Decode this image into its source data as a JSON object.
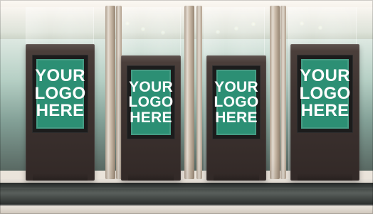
{
  "scene": {
    "kiosks": [
      {
        "line1": "YOUR",
        "line2": "LOGO",
        "line3": "HERE"
      },
      {
        "line1": "YOUR",
        "line2": "LOGO",
        "line3": "HERE"
      },
      {
        "line1": "YOUR",
        "line2": "LOGO",
        "line3": "HERE"
      },
      {
        "line1": "YOUR",
        "line2": "LOGO",
        "line3": "HERE"
      }
    ]
  },
  "colors": {
    "screen_green": "#2c8f74",
    "kiosk_dark": "#3f3431"
  }
}
